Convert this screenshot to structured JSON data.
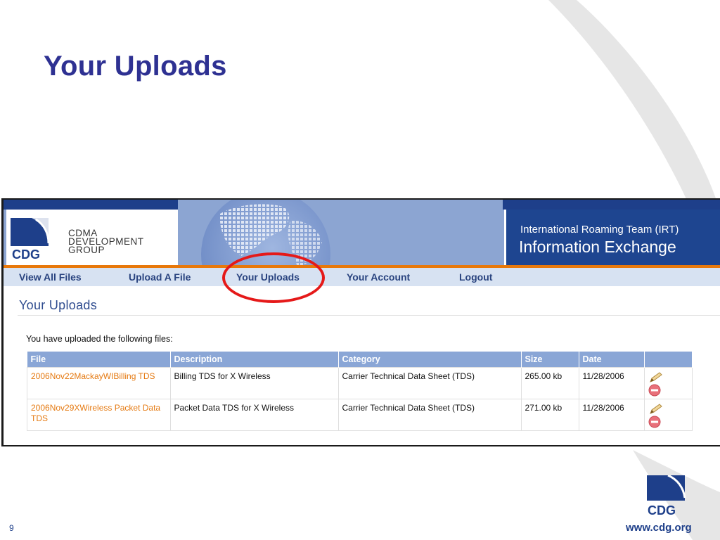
{
  "slide": {
    "title": "Your Uploads",
    "page_number": "9",
    "website": "www.cdg.org",
    "footer_logo_text": "CDG"
  },
  "app": {
    "logo": {
      "mark_text": "CDG",
      "line1": "CDMA",
      "line2": "DEVELOPMENT",
      "line3": "GROUP"
    },
    "banner": {
      "line1": "International Roaming Team (IRT)",
      "line2": "Information Exchange"
    },
    "nav": [
      {
        "label": "View All Files"
      },
      {
        "label": "Upload A File"
      },
      {
        "label": "Your Uploads"
      },
      {
        "label": "Your Account"
      },
      {
        "label": "Logout"
      }
    ],
    "page_heading": "Your Uploads",
    "intro_text": "You have uploaded the following files:",
    "table": {
      "headers": [
        "File",
        "Description",
        "Category",
        "Size",
        "Date",
        ""
      ],
      "rows": [
        {
          "file": "2006Nov22MackayWIBilling TDS",
          "description": "Billing TDS for X Wireless",
          "category": "Carrier Technical Data Sheet (TDS)",
          "size": "265.00 kb",
          "date": "11/28/2006"
        },
        {
          "file": "2006Nov29XWireless Packet Data TDS",
          "description": "Packet Data TDS for X Wireless",
          "category": "Carrier Technical Data Sheet (TDS)",
          "size": "271.00 kb",
          "date": "11/28/2006"
        }
      ]
    }
  },
  "colors": {
    "slide_title": "#2e3192",
    "highlight_circle": "#e51919",
    "nav_text": "#29437f",
    "file_link": "#e57a12",
    "table_header": "#8aa6d6"
  },
  "icons": {
    "edit": "pencil-icon",
    "delete": "delete-circle-icon"
  }
}
